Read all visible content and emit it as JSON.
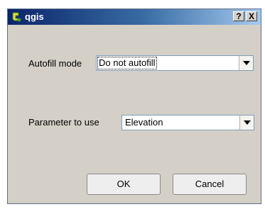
{
  "window": {
    "title": "qgis",
    "help_label": "?",
    "close_label": "X"
  },
  "form": {
    "autofill_label": "Autofill mode",
    "autofill_value": "Do not autofill",
    "parameter_label": "Parameter to use",
    "parameter_value": "Elevation"
  },
  "buttons": {
    "ok_label": "OK",
    "cancel_label": "Cancel"
  },
  "colors": {
    "titlebar_start": "#0a246a",
    "titlebar_end": "#a6caf0",
    "dialog_bg": "#d4d0c8"
  }
}
